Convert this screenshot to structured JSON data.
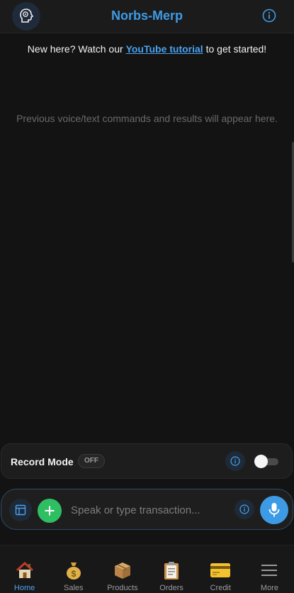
{
  "header": {
    "title": "Norbs-Merp",
    "logo_icon": "brain-head-icon",
    "info_icon": "info-icon"
  },
  "welcome": {
    "prefix": "New here? Watch our ",
    "link_text": "YouTube tutorial",
    "suffix": " to get started!"
  },
  "history": {
    "empty_message": "Previous voice/text commands and results will appear here."
  },
  "record_mode": {
    "label": "Record Mode",
    "status": "OFF",
    "toggle_on": false
  },
  "command_bar": {
    "placeholder": "Speak or type transaction...",
    "value": ""
  },
  "nav": {
    "items": [
      {
        "label": "Home",
        "icon": "house-icon",
        "active": true
      },
      {
        "label": "Sales",
        "icon": "money-bag-icon",
        "active": false
      },
      {
        "label": "Products",
        "icon": "package-icon",
        "active": false
      },
      {
        "label": "Orders",
        "icon": "clipboard-icon",
        "active": false
      },
      {
        "label": "Credit",
        "icon": "credit-card-icon",
        "active": false
      },
      {
        "label": "More",
        "icon": "menu-icon",
        "active": false
      }
    ]
  },
  "colors": {
    "accent": "#3d9be6",
    "add_green": "#2fbf63",
    "background": "#131313"
  }
}
